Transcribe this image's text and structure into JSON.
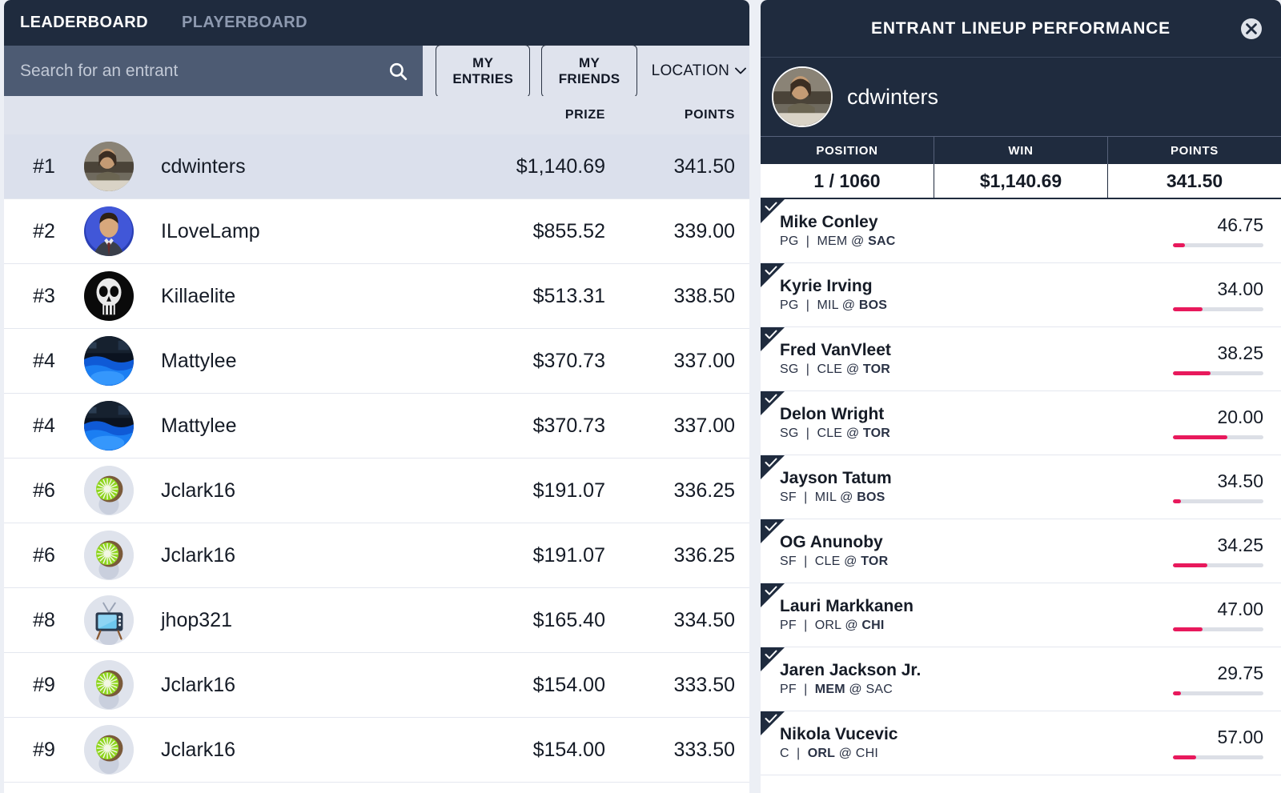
{
  "theme": {
    "navy": "#1f2b3e",
    "panel_bg": "#ffffff",
    "page_bg": "#eceff5",
    "accent_pink": "#e8195c",
    "search_bg": "#4d5b73",
    "row_selected": "#dbe0ec"
  },
  "left": {
    "tabs": [
      {
        "label": "LEADERBOARD",
        "active": true
      },
      {
        "label": "PLAYERBOARD",
        "active": false
      }
    ],
    "search": {
      "placeholder": "Search for an entrant",
      "value": "",
      "icon": "search-icon"
    },
    "filters": {
      "my_entries": "MY ENTRIES",
      "my_friends": "MY FRIENDS",
      "location": "LOCATION",
      "location_icon": "chevron-down-icon"
    },
    "columns": {
      "prize": "PRIZE",
      "points": "POINTS"
    },
    "rows": [
      {
        "rank": "#1",
        "name": "cdwinters",
        "prize": "$1,140.69",
        "points": "341.50",
        "avatar": "photo-man",
        "selected": true
      },
      {
        "rank": "#2",
        "name": "ILoveLamp",
        "prize": "$855.52",
        "points": "339.00",
        "avatar": "photo-suit",
        "selected": false
      },
      {
        "rank": "#3",
        "name": "Killaelite",
        "prize": "$513.31",
        "points": "338.50",
        "avatar": "skull",
        "selected": false
      },
      {
        "rank": "#4",
        "name": "Mattylee",
        "prize": "$370.73",
        "points": "337.00",
        "avatar": "photo-pool",
        "selected": false
      },
      {
        "rank": "#4",
        "name": "Mattylee",
        "prize": "$370.73",
        "points": "337.00",
        "avatar": "photo-pool",
        "selected": false
      },
      {
        "rank": "#6",
        "name": "Jclark16",
        "prize": "$191.07",
        "points": "336.25",
        "avatar": "kiwi",
        "selected": false
      },
      {
        "rank": "#6",
        "name": "Jclark16",
        "prize": "$191.07",
        "points": "336.25",
        "avatar": "kiwi",
        "selected": false
      },
      {
        "rank": "#8",
        "name": "jhop321",
        "prize": "$165.40",
        "points": "334.50",
        "avatar": "tv",
        "selected": false
      },
      {
        "rank": "#9",
        "name": "Jclark16",
        "prize": "$154.00",
        "points": "333.50",
        "avatar": "kiwi",
        "selected": false
      },
      {
        "rank": "#9",
        "name": "Jclark16",
        "prize": "$154.00",
        "points": "333.50",
        "avatar": "kiwi",
        "selected": false
      }
    ]
  },
  "right": {
    "title": "ENTRANT LINEUP PERFORMANCE",
    "close_icon": "close-icon",
    "entrant": {
      "name": "cdwinters",
      "avatar": "photo-man"
    },
    "stats": {
      "headers": [
        "POSITION",
        "WIN",
        "POINTS"
      ],
      "values": [
        "1 / 1060",
        "$1,140.69",
        "341.50"
      ]
    },
    "players": [
      {
        "name": "Mike Conley",
        "pos": "PG",
        "away": "MEM",
        "home": "SAC",
        "home_bold": true,
        "score": "46.75",
        "bar_pct": 13
      },
      {
        "name": "Kyrie Irving",
        "pos": "PG",
        "away": "MIL",
        "home": "BOS",
        "home_bold": true,
        "score": "34.00",
        "bar_pct": 33
      },
      {
        "name": "Fred VanVleet",
        "pos": "SG",
        "away": "CLE",
        "home": "TOR",
        "home_bold": true,
        "score": "38.25",
        "bar_pct": 42
      },
      {
        "name": "Delon Wright",
        "pos": "SG",
        "away": "CLE",
        "home": "TOR",
        "home_bold": true,
        "score": "20.00",
        "bar_pct": 60
      },
      {
        "name": "Jayson Tatum",
        "pos": "SF",
        "away": "MIL",
        "home": "BOS",
        "home_bold": true,
        "score": "34.50",
        "bar_pct": 9
      },
      {
        "name": "OG Anunoby",
        "pos": "SF",
        "away": "CLE",
        "home": "TOR",
        "home_bold": true,
        "score": "34.25",
        "bar_pct": 38
      },
      {
        "name": "Lauri Markkanen",
        "pos": "PF",
        "away": "ORL",
        "home": "CHI",
        "home_bold": true,
        "score": "47.00",
        "bar_pct": 33
      },
      {
        "name": "Jaren Jackson Jr.",
        "pos": "PF",
        "away": "MEM",
        "home": "SAC",
        "home_bold": false,
        "score": "29.75",
        "bar_pct": 9
      },
      {
        "name": "Nikola Vucevic",
        "pos": "C",
        "away": "ORL",
        "home": "CHI",
        "home_bold": false,
        "score": "57.00",
        "bar_pct": 26
      }
    ]
  }
}
